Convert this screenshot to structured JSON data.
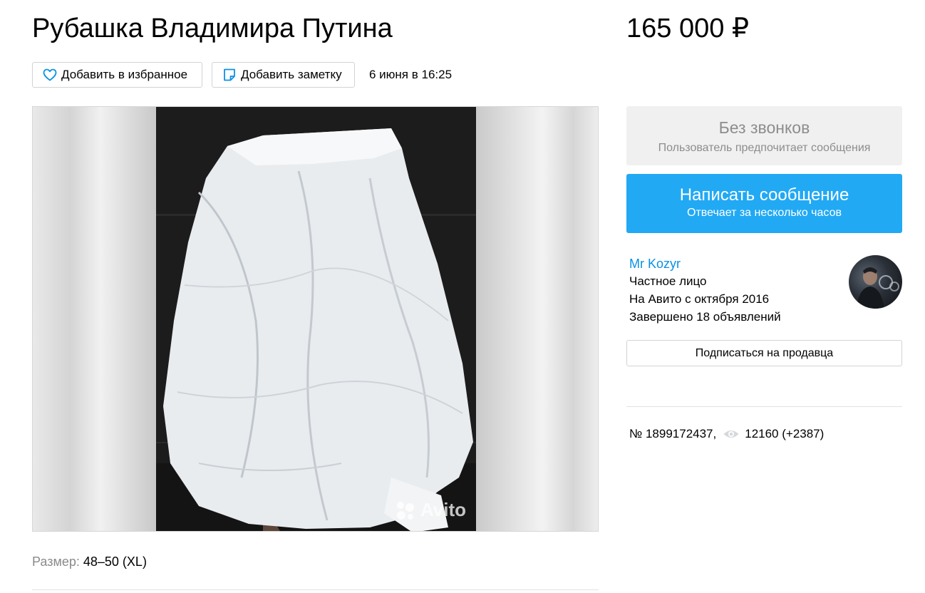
{
  "listing": {
    "title": "Рубашка Владимира Путина",
    "price": "165 000 ₽",
    "date": "6 июня в 16:25",
    "size_label": "Размер:",
    "size_value": " 48–50 (XL)"
  },
  "actions": {
    "favorite_label": "Добавить в избранное",
    "note_label": "Добавить заметку"
  },
  "gallery": {
    "watermark": "Avito"
  },
  "contact": {
    "no_calls_title": "Без звонков",
    "no_calls_subtitle": "Пользователь предпочитает сообщения",
    "message_button": "Написать сообщение",
    "message_subtitle": "Отвечает за несколько часов"
  },
  "seller": {
    "name": "Mr Kozyr",
    "type": "Частное лицо",
    "since": "На Авито с октября 2016",
    "completed": "Завершено 18 объявлений",
    "subscribe_label": "Подписаться на продавца"
  },
  "meta": {
    "item_number": "№ 1899172437,",
    "views": "12160 (+2387)"
  },
  "colors": {
    "accent": "#22a9f4",
    "link": "#0a91e2",
    "muted": "#8d8d8d"
  },
  "icons": {
    "favorite": "heart-icon",
    "note": "note-icon",
    "views": "eye-icon"
  }
}
